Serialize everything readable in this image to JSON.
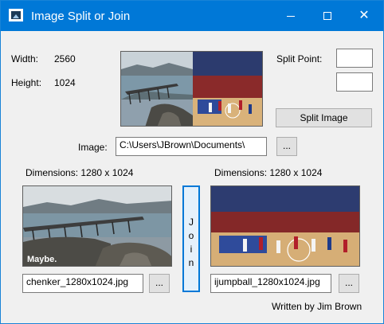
{
  "window": {
    "title": "Image Split or Join",
    "icon": "image-icon",
    "minimize_icon": "minimize-icon",
    "maximize_icon": "maximize-icon",
    "close_icon": "close-icon"
  },
  "info": {
    "width_label": "Width:",
    "width_value": "2560",
    "height_label": "Height:",
    "height_value": "1024"
  },
  "split": {
    "split_point_label": "Split Point:",
    "split_point_value_1": "",
    "split_point_value_2": "",
    "split_button_label": "Split Image"
  },
  "image": {
    "label": "Image:",
    "path": "C:\\Users\\JBrown\\Documents\\",
    "browse_label": "..."
  },
  "left": {
    "dimensions_label": "Dimensions: 1280 x 1024",
    "caption": "Maybe.",
    "file": "chenker_1280x1024.jpg",
    "browse_label": "..."
  },
  "right": {
    "dimensions_label": "Dimensions: 1280 x 1024",
    "file": "ijumpball_1280x1024.jpg",
    "browse_label": "..."
  },
  "join_button_label": "J o i n",
  "footer": "Written by Jim Brown"
}
